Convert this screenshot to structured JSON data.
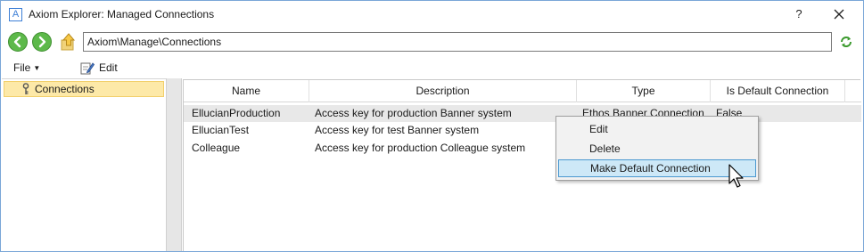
{
  "window": {
    "app_icon_letter": "A",
    "title": "Axiom Explorer: Managed Connections",
    "help_label": "?"
  },
  "address": {
    "path": "Axiom\\Manage\\Connections"
  },
  "menu": {
    "file_label": "File",
    "edit_label": "Edit"
  },
  "tree": {
    "items": [
      {
        "label": "Connections",
        "selected": true
      }
    ]
  },
  "grid": {
    "columns": [
      "Name",
      "Description",
      "Type",
      "Is Default Connection"
    ],
    "rows": [
      {
        "name": "EllucianProduction",
        "description": "Access key for production Banner system",
        "type": "Ethos Banner Connection",
        "is_default": "False",
        "selected": true
      },
      {
        "name": "EllucianTest",
        "description": "Access key for test Banner system",
        "type": "",
        "is_default": ""
      },
      {
        "name": "Colleague",
        "description": "Access key for production Colleague system",
        "type": "",
        "is_default": ""
      }
    ]
  },
  "context_menu": {
    "items": [
      "Edit",
      "Delete",
      "Make Default Connection"
    ],
    "highlighted_index": 2
  },
  "colors": {
    "nav_green": "#5db94a",
    "tree_selected": "#fde9a8",
    "menu_highlight": "#cde8f7",
    "row_selected": "#e8e8e8"
  }
}
